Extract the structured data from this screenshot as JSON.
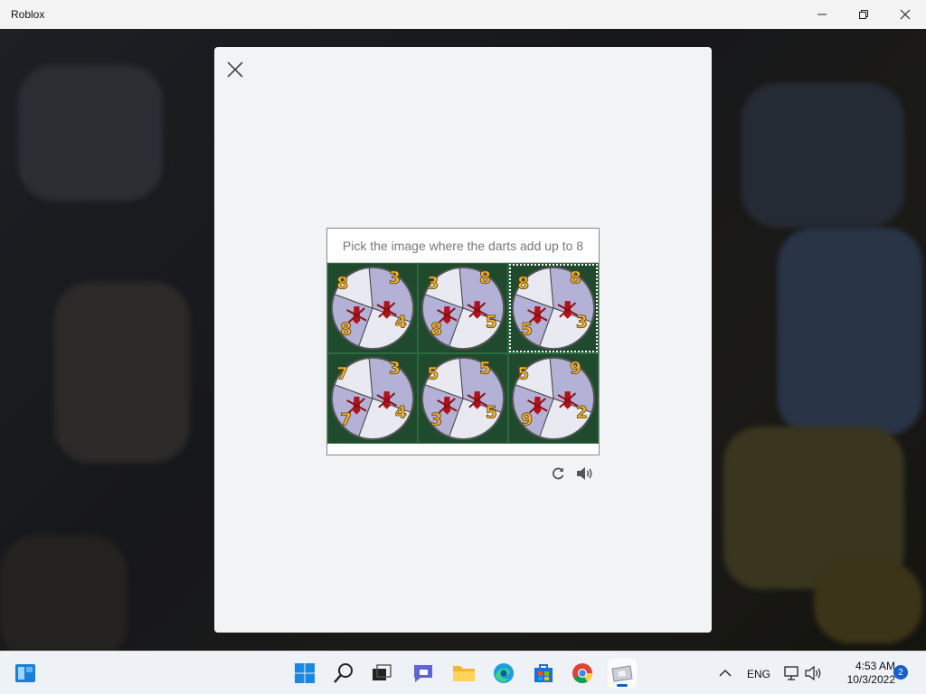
{
  "window": {
    "title": "Roblox"
  },
  "captcha": {
    "prompt": "Pick the image where the darts add up to 8",
    "cells": [
      {
        "numbers": [
          "8",
          "3",
          "4",
          "8"
        ]
      },
      {
        "numbers": [
          "3",
          "8",
          "5",
          "8"
        ]
      },
      {
        "numbers": [
          "8",
          "8",
          "3",
          "5"
        ]
      },
      {
        "numbers": [
          "7",
          "3",
          "4",
          "7"
        ]
      },
      {
        "numbers": [
          "5",
          "5",
          "5",
          "3"
        ]
      },
      {
        "numbers": [
          "5",
          "9",
          "2",
          "9"
        ]
      }
    ],
    "selected_index": 2,
    "tools": [
      "refresh-icon",
      "audio-icon"
    ]
  },
  "taskbar": {
    "apps": [
      "windows-start-icon",
      "search-icon",
      "task-view-icon",
      "teams-chat-icon",
      "file-explorer-icon",
      "edge-icon",
      "microsoft-store-icon",
      "chrome-icon",
      "roblox-icon"
    ],
    "language": "ENG",
    "time": "4:53 AM",
    "date": "10/3/2022",
    "notifications": "2"
  },
  "colors": {
    "accent": "#0a64c8",
    "number": "#f2b632",
    "board": "#1f4a2e"
  }
}
